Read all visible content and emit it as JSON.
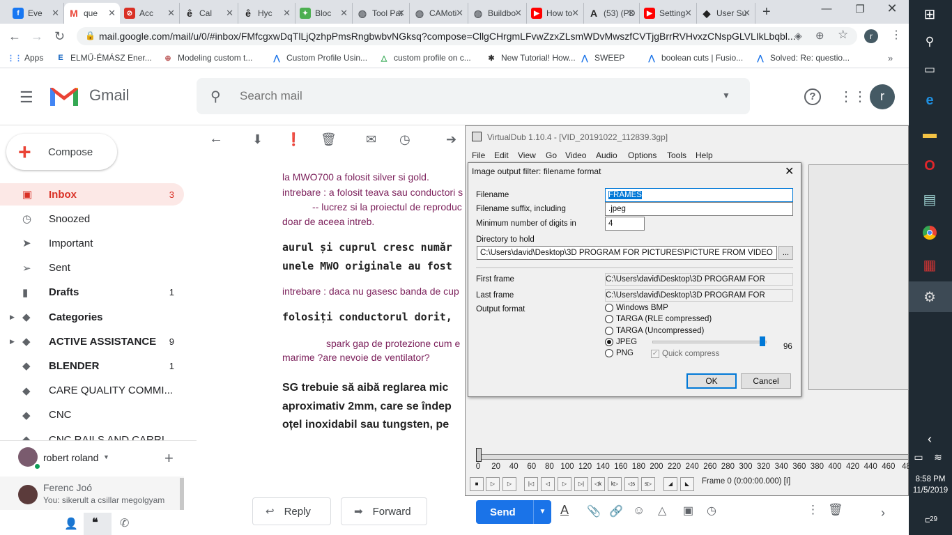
{
  "browser": {
    "tabs": [
      {
        "label": "Eve",
        "icon": "facebook-icon",
        "color": "#1877f2"
      },
      {
        "label": "que",
        "icon": "gmail-icon",
        "color": "#ea4335",
        "active": true
      },
      {
        "label": "Acc",
        "icon": "blocked-icon",
        "color": "#d93025"
      },
      {
        "label": "Cal",
        "icon": "e-icon",
        "color": "#222222"
      },
      {
        "label": "Hyc",
        "icon": "e-icon",
        "color": "#222222"
      },
      {
        "label": "Bloc",
        "icon": "puzzle-icon",
        "color": "#4caf50"
      },
      {
        "label": "Tool Pat",
        "icon": "globe-icon",
        "color": "#5f6368"
      },
      {
        "label": "CAMoti",
        "icon": "globe-icon",
        "color": "#5f6368"
      },
      {
        "label": "Buildbo",
        "icon": "globe-icon",
        "color": "#5f6368"
      },
      {
        "label": "How to",
        "icon": "youtube-icon",
        "color": "#ff0000"
      },
      {
        "label": "(53) (PD",
        "icon": "a-icon",
        "color": "#222222"
      },
      {
        "label": "Setting",
        "icon": "youtube-icon",
        "color": "#ff0000"
      },
      {
        "label": "User Su",
        "icon": "diamond-icon",
        "color": "#222222"
      }
    ],
    "url": "mail.google.com/mail/u/0/#inbox/FMfcgxwDqTlLjQzhpPmsRngbwbvNGksq?compose=CllgCHrgmLFvwZzxZLsmWDvMwszfCVTjgBrrRVHvxzCNspGLVLIkLbqbl...",
    "bookmarks": [
      {
        "label": "Apps"
      },
      {
        "label": "ELMŰ-ÉMÁSZ Ener..."
      },
      {
        "label": "Modeling custom t..."
      },
      {
        "label": "Custom Profile Usin..."
      },
      {
        "label": "custom profile on c..."
      },
      {
        "label": "New Tutorial! How..."
      },
      {
        "label": "SWEEP"
      },
      {
        "label": "boolean cuts | Fusio..."
      },
      {
        "label": "Solved: Re: questio..."
      }
    ],
    "profile_initial": "r"
  },
  "gmail": {
    "logo_text": "Gmail",
    "search_placeholder": "Search mail",
    "avatar_initial": "r",
    "compose_label": "Compose",
    "nav": [
      {
        "label": "Inbox",
        "count": "3",
        "icon": "inbox-icon",
        "bold": true,
        "active": true
      },
      {
        "label": "Snoozed",
        "count": "",
        "icon": "clock-icon"
      },
      {
        "label": "Important",
        "count": "",
        "icon": "important-icon"
      },
      {
        "label": "Sent",
        "count": "",
        "icon": "send-icon"
      },
      {
        "label": "Drafts",
        "count": "1",
        "icon": "draft-icon",
        "bold": true
      },
      {
        "label": "Categories",
        "count": "",
        "icon": "label-icon",
        "bold": true,
        "expand": true
      },
      {
        "label": "ACTIVE ASSISTANCE",
        "count": "9",
        "icon": "label-icon",
        "bold": true,
        "expand": true
      },
      {
        "label": "BLENDER",
        "count": "1",
        "icon": "label-icon",
        "bold": true
      },
      {
        "label": "CARE QUALITY COMMI...",
        "count": "",
        "icon": "label-icon"
      },
      {
        "label": "CNC",
        "count": "",
        "icon": "label-icon"
      },
      {
        "label": "CNC RAILS AND CARRI...",
        "count": "",
        "icon": "label-icon"
      }
    ],
    "hangouts": {
      "me": "robert roland",
      "contact_name": "Ferenc Joó",
      "contact_msg": "You: sikerult a csillar megolgyam"
    },
    "message_lines": {
      "l1": "la MWO700 a folosit silver si gold.",
      "l2": "intrebare : a folosit teava sau conductori s",
      "l3": "-- lucrez si la proiectul de reproduc",
      "l4": "doar de aceea intreb.",
      "m1": "aurul și cuprul cresc număr",
      "m2": "unele MWO originale au fost",
      "l5": "intrebare : daca nu gasesc banda de cup",
      "m3": "folosiți conductorul dorit,",
      "l6": "spark gap de protezione cum e",
      "l7": "marime ?are nevoie de ventilator?",
      "b1": "SG trebuie să aibă reglarea mic",
      "b2": "aproximativ 2mm, care se îndep",
      "b3": "oțel inoxidabil sau tungsten, pe"
    },
    "reply_label": "Reply",
    "forward_label": "Forward",
    "send_label": "Send"
  },
  "vdub": {
    "title": "VirtualDub 1.10.4 - [VID_20191022_112839.3gp]",
    "menu": [
      "File",
      "Edit",
      "View",
      "Go",
      "Video",
      "Audio",
      "Options",
      "Tools",
      "Help"
    ],
    "ticks": [
      "0",
      "20",
      "40",
      "60",
      "80",
      "100",
      "120",
      "140",
      "160",
      "180",
      "200",
      "220",
      "240",
      "260",
      "280",
      "300",
      "320",
      "340",
      "360",
      "380",
      "400",
      "420",
      "440",
      "460",
      "48"
    ],
    "frame_info": "Frame 0 (0:00:00.000) [I]"
  },
  "dialog": {
    "title": "Image output filter: filename format",
    "filename_label": "Filename",
    "filename_value": "FRAMES",
    "suffix_label": "Filename suffix, including",
    "suffix_value": ".jpeg",
    "digits_label": "Minimum number of digits in",
    "digits_value": "4",
    "dir_label": "Directory to hold",
    "dir_value": "C:\\Users\\david\\Desktop\\3D PROGRAM FOR PICTURES\\PICTURE FROM VIDEO",
    "browse_label": "...",
    "first_label": "First frame",
    "first_value": "C:\\Users\\david\\Desktop\\3D PROGRAM FOR",
    "last_label": "Last frame",
    "last_value": "C:\\Users\\david\\Desktop\\3D PROGRAM FOR",
    "format_label": "Output format",
    "formats": [
      "Windows BMP",
      "TARGA (RLE compressed)",
      "TARGA (Uncompressed)",
      "JPEG",
      "PNG"
    ],
    "selected_format": "JPEG",
    "quality_value": "96",
    "quick_compress": "Quick compress",
    "ok_label": "OK",
    "cancel_label": "Cancel"
  },
  "taskbar": {
    "time": "8:58 PM",
    "date": "11/5/2019",
    "notifications": "29"
  }
}
